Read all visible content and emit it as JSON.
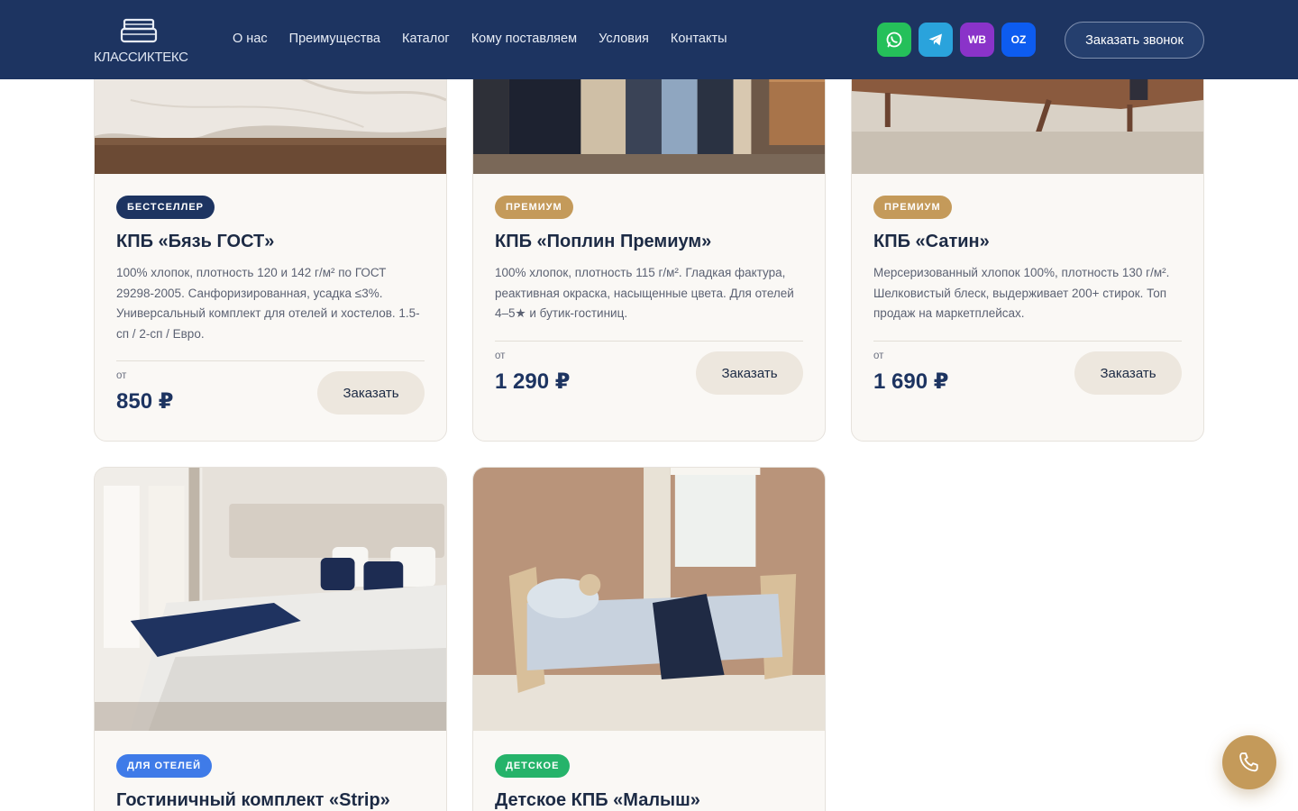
{
  "brand": {
    "name": "КЛАССИКТЕКС"
  },
  "nav": [
    "О нас",
    "Преимущества",
    "Каталог",
    "Кому поставляем",
    "Условия",
    "Контакты"
  ],
  "socials": {
    "whatsapp": "whatsapp-icon",
    "telegram": "telegram-icon",
    "wb": "WB",
    "ozon": "OZ"
  },
  "header": {
    "call_button": "Заказать звонок"
  },
  "price_from": "от",
  "order_label": "Заказать",
  "products": [
    {
      "badge": "БЕСТСЕЛЛЕР",
      "title": "КПБ «Бязь ГОСТ»",
      "description": "100% хлопок, плотность 120 и 142 г/м² по ГОСТ 29298-2005. Санфоризированная, усадка ≤3%. Универсальный комплект для отелей и хостелов. 1.5-сп / 2-сп / Евро.",
      "price": "850 ₽"
    },
    {
      "badge": "ПРЕМИУМ",
      "title": "КПБ «Поплин Премиум»",
      "description": "100% хлопок, плотность 115 г/м². Гладкая фактура, реактивная окраска, насыщенные цвета. Для отелей 4–5★ и бутик-гостиниц.",
      "price": "1 290 ₽"
    },
    {
      "badge": "ПРЕМИУМ",
      "title": "КПБ «Сатин»",
      "description": "Мерсеризованный хлопок 100%, плотность 130 г/м². Шелковистый блеск, выдерживает 200+ стирок. Топ продаж на маркетплейсах.",
      "price": "1 690 ₽"
    },
    {
      "badge": "ДЛЯ ОТЕЛЕЙ",
      "title": "Гостиничный комплект «Strip»"
    },
    {
      "badge": "ДЕТСКОЕ",
      "title": "Детское КПБ «Малыш»"
    }
  ],
  "colors": {
    "header_bg": "#1d3461",
    "accent_gold": "#c49a5a",
    "card_bg": "#faf8f5"
  }
}
